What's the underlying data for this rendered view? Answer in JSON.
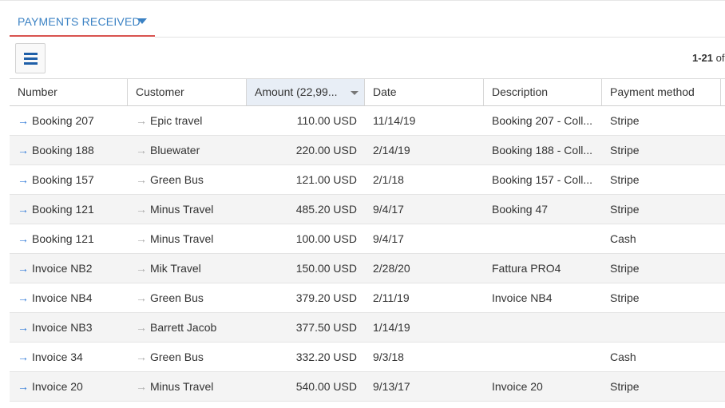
{
  "tab": {
    "label": "PAYMENTS RECEIVED"
  },
  "pager": {
    "range": "1-21",
    "suffix": " of"
  },
  "columns": [
    {
      "label": "Number"
    },
    {
      "label": "Customer"
    },
    {
      "label": "Amount (22,99..."
    },
    {
      "label": "Date"
    },
    {
      "label": "Description"
    },
    {
      "label": "Payment method"
    }
  ],
  "rows": [
    {
      "number": "Booking 207",
      "customer": "Epic travel",
      "amount": "110.00 USD",
      "date": "11/14/19",
      "description": "Booking 207 - Coll...",
      "method": "Stripe"
    },
    {
      "number": "Booking 188",
      "customer": "Bluewater",
      "amount": "220.00 USD",
      "date": "2/14/19",
      "description": "Booking 188 - Coll...",
      "method": "Stripe"
    },
    {
      "number": "Booking 157",
      "customer": "Green Bus",
      "amount": "121.00 USD",
      "date": "2/1/18",
      "description": "Booking 157 - Coll...",
      "method": "Stripe"
    },
    {
      "number": "Booking 121",
      "customer": "Minus Travel",
      "amount": "485.20 USD",
      "date": "9/4/17",
      "description": "Booking 47",
      "method": "Stripe"
    },
    {
      "number": "Booking 121",
      "customer": "Minus Travel",
      "amount": "100.00 USD",
      "date": "9/4/17",
      "description": "",
      "method": "Cash"
    },
    {
      "number": "Invoice NB2",
      "customer": "Mik Travel",
      "amount": "150.00 USD",
      "date": "2/28/20",
      "description": "Fattura PRO4",
      "method": "Stripe"
    },
    {
      "number": "Invoice NB4",
      "customer": "Green Bus",
      "amount": "379.20 USD",
      "date": "2/11/19",
      "description": "Invoice NB4",
      "method": "Stripe"
    },
    {
      "number": "Invoice NB3",
      "customer": "Barrett Jacob",
      "amount": "377.50 USD",
      "date": "1/14/19",
      "description": "",
      "method": ""
    },
    {
      "number": "Invoice 34",
      "customer": "Green Bus",
      "amount": "332.20 USD",
      "date": "9/3/18",
      "description": "",
      "method": "Cash"
    },
    {
      "number": "Invoice 20",
      "customer": "Minus Travel",
      "amount": "540.00 USD",
      "date": "9/13/17",
      "description": "Invoice 20",
      "method": "Stripe"
    }
  ],
  "icons": {
    "number_link": "arrow-right-icon",
    "customer_link": "arrow-right-icon",
    "menu": "hamburger-menu-icon",
    "tab_dropdown": "caret-down-icon",
    "sort": "caret-down-icon"
  },
  "colors": {
    "accent": "#3b82c4",
    "tab_underline": "#d9534f",
    "link_arrow": "#2f7ad8",
    "muted_arrow": "#a8a8a8"
  }
}
